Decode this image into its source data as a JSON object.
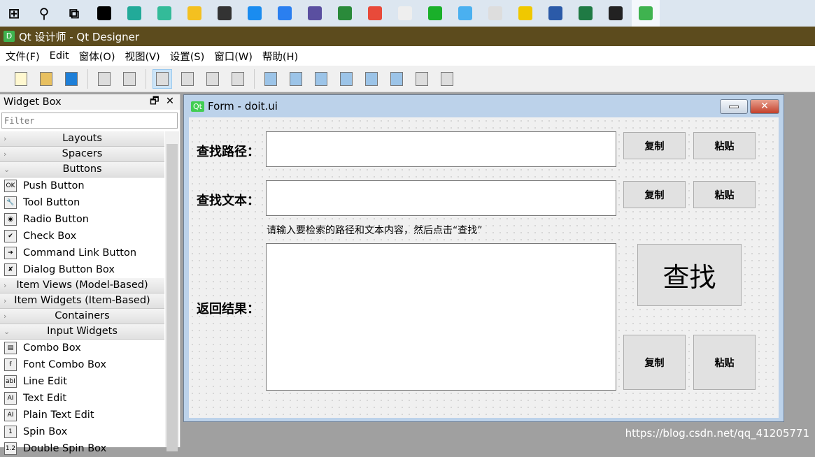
{
  "taskbar": {
    "icons": [
      "windows-start",
      "search",
      "task-view",
      "intellij",
      "pycharm",
      "app-green",
      "file-explorer",
      "sublime",
      "app-blue-star",
      "browser",
      "app-purple",
      "app-globe",
      "app-red-x",
      "typora",
      "wechat",
      "app-diamond",
      "app-monitor",
      "app-music",
      "word",
      "excel",
      "terminal",
      "qt-designer"
    ]
  },
  "window": {
    "title": "Qt 设计师 - Qt Designer",
    "logo": "D"
  },
  "menu": [
    "文件(F)",
    "Edit",
    "窗体(O)",
    "视图(V)",
    "设置(S)",
    "窗口(W)",
    "帮助(H)"
  ],
  "toolbar": [
    "new",
    "open",
    "save",
    "|",
    "copy",
    "paste",
    "|",
    "edit-widgets",
    "edit-signals",
    "edit-buddies",
    "edit-tab-order",
    "|",
    "layout-horizontal",
    "layout-vertical",
    "layout-h-splitter",
    "layout-v-splitter",
    "layout-grid",
    "layout-form",
    "break-layout",
    "adjust-size"
  ],
  "widget_box": {
    "title": "Widget Box",
    "filter_placeholder": "Filter",
    "rows": [
      {
        "type": "cat",
        "label": "Layouts",
        "open": false
      },
      {
        "type": "cat",
        "label": "Spacers",
        "open": false
      },
      {
        "type": "cat",
        "label": "Buttons",
        "open": true
      },
      {
        "type": "item",
        "label": "Push Button",
        "icon": "OK"
      },
      {
        "type": "item",
        "label": "Tool Button",
        "icon": "🔧"
      },
      {
        "type": "item",
        "label": "Radio Button",
        "icon": "◉"
      },
      {
        "type": "item",
        "label": "Check Box",
        "icon": "✔"
      },
      {
        "type": "item",
        "label": "Command Link Button",
        "icon": "➔"
      },
      {
        "type": "item",
        "label": "Dialog Button Box",
        "icon": "✘"
      },
      {
        "type": "cat",
        "label": "Item Views (Model-Based)",
        "open": false
      },
      {
        "type": "cat",
        "label": "Item Widgets (Item-Based)",
        "open": false
      },
      {
        "type": "cat",
        "label": "Containers",
        "open": false
      },
      {
        "type": "cat",
        "label": "Input Widgets",
        "open": true
      },
      {
        "type": "item",
        "label": "Combo Box",
        "icon": "▤"
      },
      {
        "type": "item",
        "label": "Font Combo Box",
        "icon": "f"
      },
      {
        "type": "item",
        "label": "Line Edit",
        "icon": "abI"
      },
      {
        "type": "item",
        "label": "Text Edit",
        "icon": "AI"
      },
      {
        "type": "item",
        "label": "Plain Text Edit",
        "icon": "AI"
      },
      {
        "type": "item",
        "label": "Spin Box",
        "icon": "1"
      },
      {
        "type": "item",
        "label": "Double Spin Box",
        "icon": "1.2"
      }
    ]
  },
  "form": {
    "title": "Form - doit.ui",
    "icon": "Qt",
    "path_label": "查找路径：",
    "text_label": "查找文本：",
    "result_label": "返回结果：",
    "path_value": "",
    "text_value": "",
    "result_value": "",
    "hint": "请输入要检索的路径和文本内容，然后点击“查找”",
    "copy": "复制",
    "paste": "粘贴",
    "find": "查找"
  },
  "watermark": "https://blog.csdn.net/qq_41205771",
  "colors": {
    "titlebar": "#5c4b1d",
    "form_frame": "#bcd2ea"
  }
}
